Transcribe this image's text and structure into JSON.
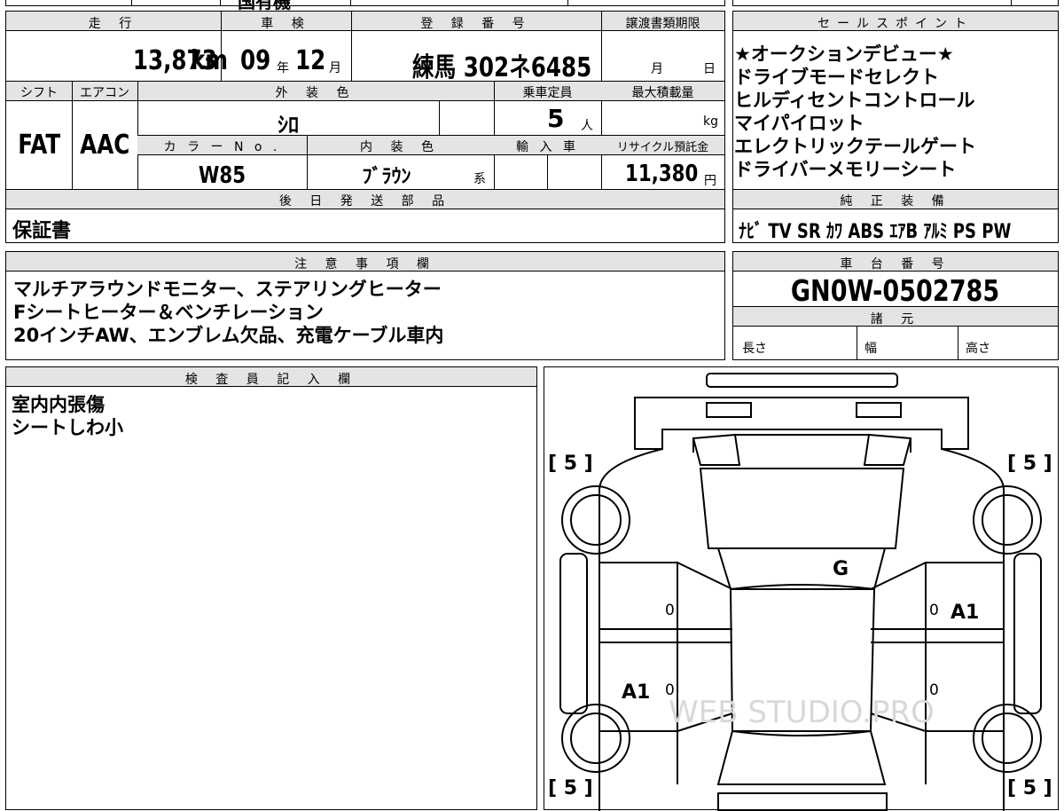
{
  "top_strip": {
    "partial": "国有機"
  },
  "headers": {
    "mileage": "走 行",
    "inspection": "車 検",
    "registration": "登 録 番 号",
    "transfer_deadline": "譲渡書類期限",
    "shift": "シフト",
    "aircon": "エアコン",
    "exterior_color": "外 装 色",
    "capacity": "乗車定員",
    "max_load": "最大積載量",
    "color_no": "カ ラ ー N o .",
    "interior_color": "内 装 色",
    "import": "輸 入 車",
    "recycle": "リサイクル預託金",
    "later_parts": "後 日 発 送 部 品",
    "sales_points": "セールスポイント",
    "equipment": "純 正 装 備",
    "notes": "注 意 事 項 欄",
    "chassis": "車 台 番 号",
    "specs": "諸 元",
    "inspector": "検 査 員 記 入 欄"
  },
  "values": {
    "mileage_num": "13,873",
    "mileage_unit": "km",
    "inspection_year": "09",
    "year_unit": "年",
    "inspection_month": "12",
    "month_unit": "月",
    "registration": "練馬 302ネ6485",
    "deadline_month": "月",
    "deadline_day": "日",
    "shift": "FAT",
    "aircon": "AAC",
    "exterior_color": "ｼﾛ",
    "capacity_num": "5",
    "capacity_unit": "人",
    "load_unit": "kg",
    "color_no": "W85",
    "interior_color": "ﾌﾞﾗｳﾝ",
    "interior_suffix": "系",
    "recycle_num": "11,380",
    "recycle_unit": "円",
    "later_parts": "保証書",
    "equipment": "ﾅﾋﾞ TV SR ｶﾜ ABS ｴｱB ｱﾙﾐ PS PW",
    "chassis": "GN0W-0502785",
    "length": "長さ",
    "width": "幅",
    "height": "高さ"
  },
  "sales_points": [
    "★オークションデビュー★",
    "ドライブモードセレクト",
    "ヒルディセントコントロール",
    "マイパイロット",
    "エレクトリックテールゲート",
    "ドライバーメモリーシート"
  ],
  "notes": [
    "マルチアラウンドモニター、ステアリングヒーター",
    "Fシートヒーター＆ベンチレーション",
    "20インチAW、エンブレム欠品、充電ケーブル車内"
  ],
  "inspector_notes": [
    "室内内張傷",
    "シートしわ小"
  ],
  "diagram": {
    "tire_tl": "[ 5 ]",
    "tire_tr": "[ 5 ]",
    "tire_bl": "[ 5 ]",
    "tire_br": "[ 5 ]",
    "mark_windshield": "G",
    "mark_right_front": "A1",
    "mark_left_rear": "A1",
    "zero_lf": "0",
    "zero_rf": "0",
    "zero_lr": "0",
    "zero_rr": "0",
    "watermark": "WEB STUDIO.PRO"
  }
}
